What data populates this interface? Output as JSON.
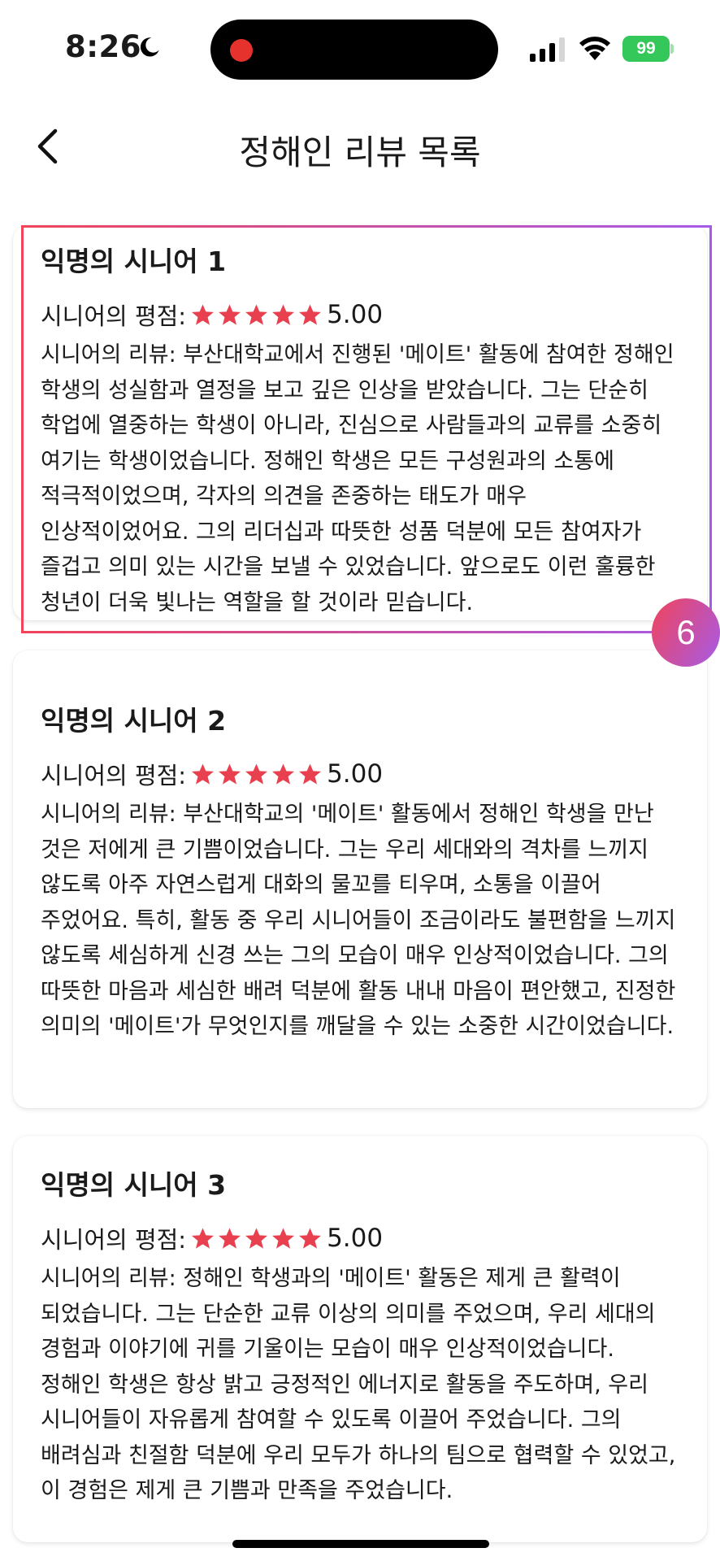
{
  "status": {
    "time": "8:26",
    "battery": "99"
  },
  "nav": {
    "title": "정해인 리뷰 목록"
  },
  "colors": {
    "star": "#e8404e",
    "highlight_start": "#f0445a",
    "highlight_end": "#a65be8",
    "battery": "#34c759"
  },
  "highlight_badge": "6",
  "reviews": [
    {
      "title": "익명의 시니어 1",
      "rating_label": "시니어의 평점:",
      "rating": "5.00",
      "text": "시니어의 리뷰: 부산대학교에서 진행된 '메이트' 활동에 참여한 정해인 학생의 성실함과 열정을 보고 깊은 인상을 받았습니다. 그는 단순히 학업에 열중하는 학생이 아니라, 진심으로 사람들과의 교류를 소중히 여기는 학생이었습니다. 정해인 학생은 모든 구성원과의 소통에 적극적이었으며, 각자의 의견을 존중하는 태도가 매우 인상적이었어요. 그의 리더십과 따뜻한 성품 덕분에 모든 참여자가 즐겁고 의미 있는 시간을 보낼 수 있었습니다. 앞으로도 이런 훌륭한 청년이 더욱 빛나는 역할을 할 것이라 믿습니다."
    },
    {
      "title": "익명의 시니어 2",
      "rating_label": "시니어의 평점:",
      "rating": "5.00",
      "text": "시니어의 리뷰: 부산대학교의 '메이트' 활동에서 정해인 학생을 만난 것은 저에게 큰 기쁨이었습니다. 그는 우리 세대와의 격차를 느끼지 않도록 아주 자연스럽게 대화의 물꼬를 티우며, 소통을 이끌어 주었어요. 특히, 활동 중 우리 시니어들이 조금이라도 불편함을 느끼지 않도록 세심하게 신경 쓰는 그의 모습이 매우 인상적이었습니다. 그의 따뜻한 마음과 세심한 배려 덕분에 활동 내내 마음이 편안했고, 진정한 의미의 '메이트'가 무엇인지를 깨달을 수 있는 소중한 시간이었습니다."
    },
    {
      "title": "익명의 시니어 3",
      "rating_label": "시니어의 평점:",
      "rating": "5.00",
      "text": "시니어의 리뷰: 정해인 학생과의 '메이트' 활동은 제게 큰 활력이 되었습니다. 그는 단순한 교류 이상의 의미를 주었으며, 우리 세대의 경험과 이야기에 귀를 기울이는 모습이 매우 인상적이었습니다. 정해인 학생은 항상 밝고 긍정적인 에너지로 활동을 주도하며, 우리 시니어들이 자유롭게 참여할 수 있도록 이끌어 주었습니다. 그의 배려심과 친절함 덕분에 우리 모두가 하나의 팀으로 협력할 수 있었고, 이 경험은 제게 큰 기쁨과 만족을 주었습니다."
    }
  ]
}
